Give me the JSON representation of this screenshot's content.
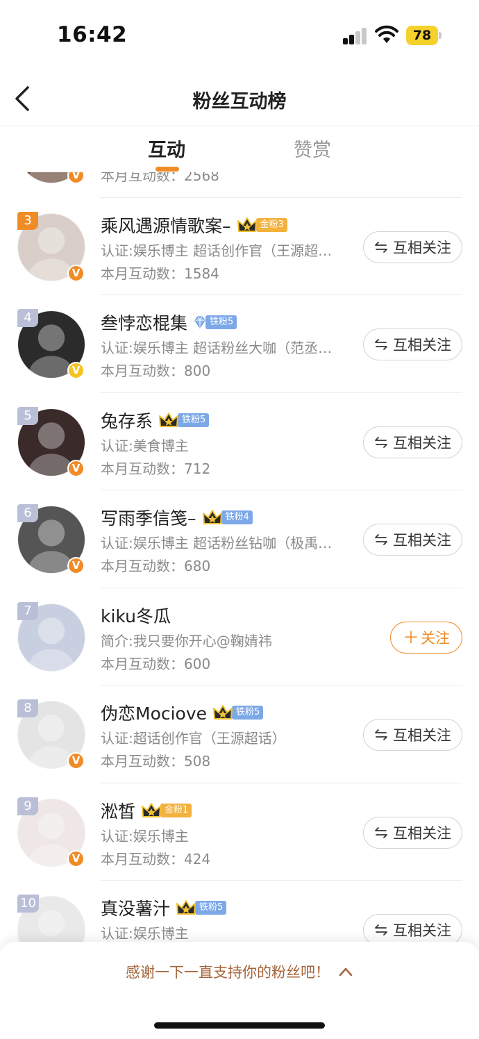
{
  "status_bar": {
    "time": "16:42",
    "battery": "78"
  },
  "nav": {
    "title": "粉丝互动榜"
  },
  "tabs": [
    {
      "label": "互动",
      "active": true
    },
    {
      "label": "赞赏",
      "active": false
    }
  ],
  "rows": [
    {
      "rank": "",
      "name": "",
      "cert": "",
      "count": "本月互动数：2568",
      "verify": "orange",
      "fan_badge": null,
      "action": "mutual",
      "avatar_color": "#6b4a3a"
    },
    {
      "rank": "3",
      "name": "乘风遇源情歌案–",
      "cert": "认证:娱乐博主 超话创作官（王源超…",
      "count": "本月互动数：1584",
      "verify": "orange",
      "fan_badge": {
        "icon": "crown-icon",
        "label": "金粉3",
        "style": "gold"
      },
      "action": "mutual",
      "avatar_color": "#d9cfc8"
    },
    {
      "rank": "4",
      "name": "叁悖恋棍集",
      "cert": "认证:娱乐博主 超话粉丝大咖（范丞…",
      "count": "本月互动数：800",
      "verify": "yellow",
      "fan_badge": {
        "icon": "diamond-icon",
        "label": "铁粉5",
        "style": "iron"
      },
      "action": "mutual",
      "avatar_color": "#2b2b2b"
    },
    {
      "rank": "5",
      "name": "兔存系",
      "cert": "认证:美食博主",
      "count": "本月互动数：712",
      "verify": "orange",
      "fan_badge": {
        "icon": "crown-icon",
        "label": "铁粉5",
        "style": "iron"
      },
      "action": "mutual",
      "avatar_color": "#3a2a2a"
    },
    {
      "rank": "6",
      "name": "写雨季信笺–",
      "cert": "认证:娱乐博主 超话粉丝钻咖（极禹…",
      "count": "本月互动数：680",
      "verify": "orange",
      "fan_badge": {
        "icon": "crown-icon",
        "label": "铁粉4",
        "style": "iron"
      },
      "action": "mutual",
      "avatar_color": "#555555"
    },
    {
      "rank": "7",
      "name": "kiku冬瓜",
      "cert": "简介:我只要你开心@鞠婧祎",
      "count": "本月互动数：600",
      "verify": null,
      "fan_badge": null,
      "action": "follow",
      "avatar_color": "#c8cfe0"
    },
    {
      "rank": "8",
      "name": "伪恋Mociove",
      "cert": "认证:超话创作官（王源超话）",
      "count": "本月互动数：508",
      "verify": "orange",
      "fan_badge": {
        "icon": "crown-icon",
        "label": "铁粉5",
        "style": "iron"
      },
      "action": "mutual",
      "avatar_color": "#e4e4e4"
    },
    {
      "rank": "9",
      "name": "淞皙",
      "cert": "认证:娱乐博主",
      "count": "本月互动数：424",
      "verify": "orange",
      "fan_badge": {
        "icon": "crown-icon",
        "label": "金粉1",
        "style": "gold"
      },
      "action": "mutual",
      "avatar_color": "#efe6e6"
    },
    {
      "rank": "10",
      "name": "真没薯汁",
      "cert": "认证:娱乐博主",
      "count": "",
      "verify": null,
      "fan_badge": {
        "icon": "crown-icon",
        "label": "铁粉5",
        "style": "iron"
      },
      "action": "mutual",
      "avatar_color": "#e9e9e9"
    }
  ],
  "actions": {
    "mutual": "互相关注",
    "follow": "关注",
    "follow_plus": "＋"
  },
  "bottom": {
    "thanks": "感谢一下一直支持你的粉丝吧！"
  },
  "colors": {
    "accent": "#f08c28",
    "iron_fan": "#7da8e8",
    "gold_fan": "#f3b23d"
  }
}
